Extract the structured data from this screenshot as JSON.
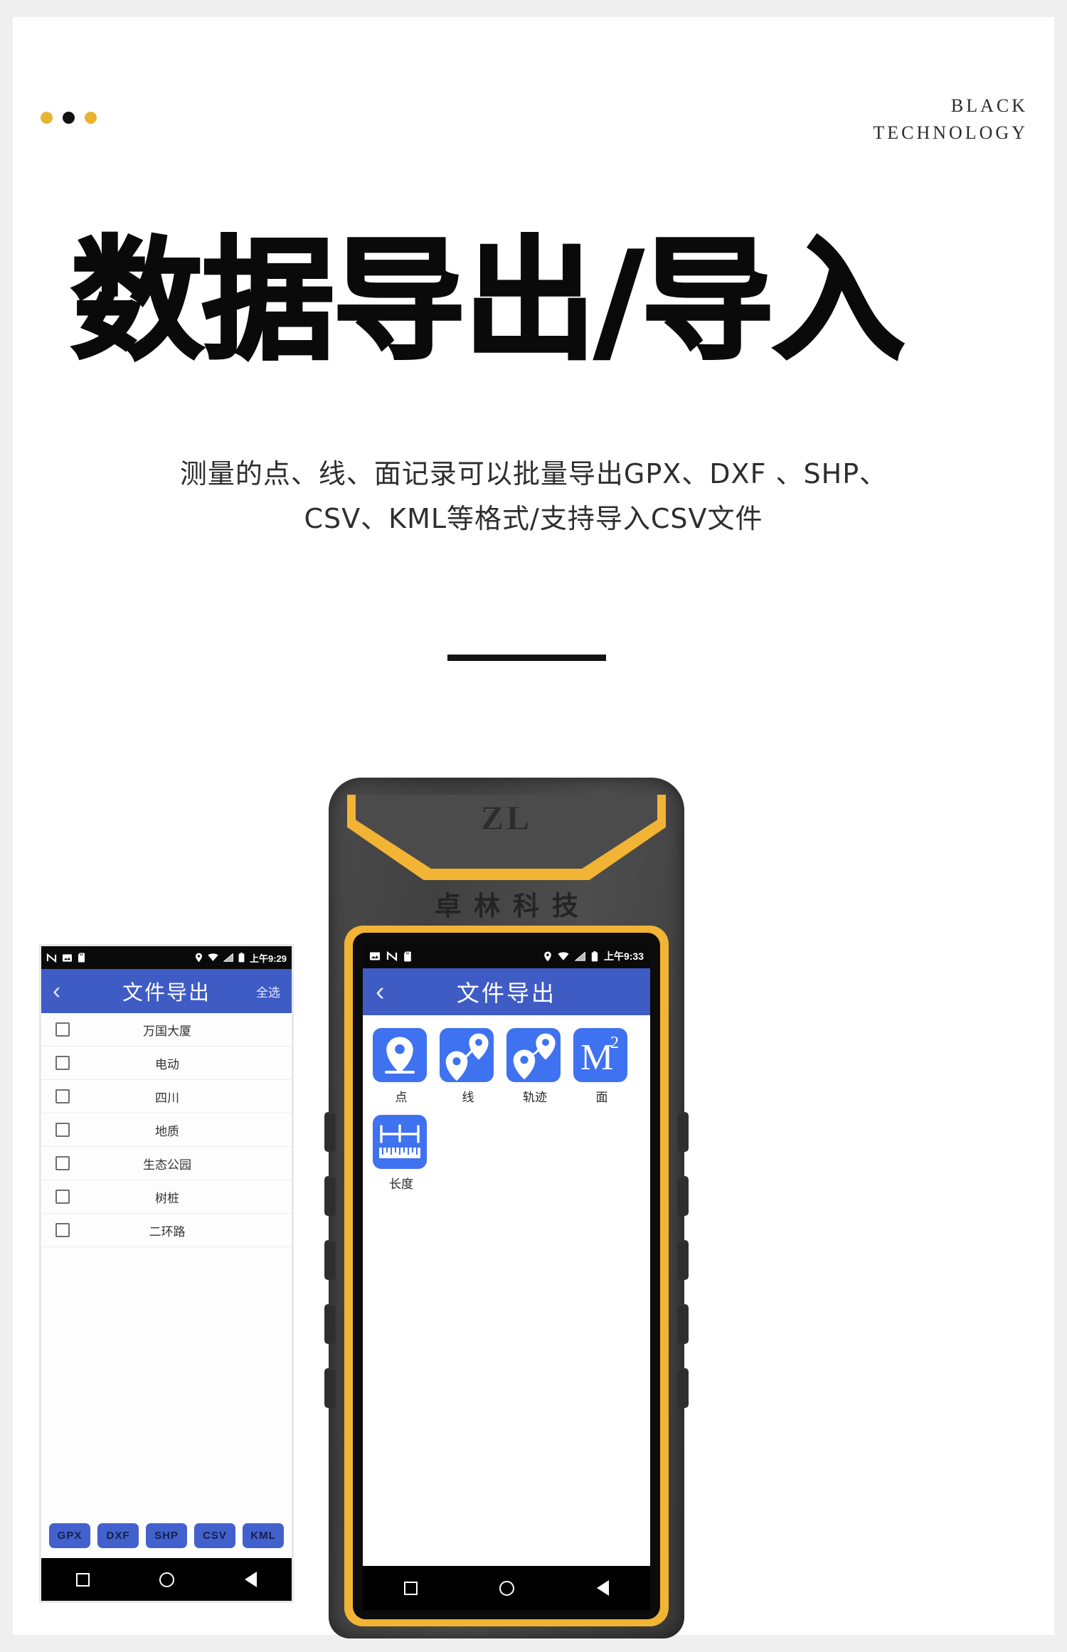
{
  "page": {
    "brand_line1": "BLACK",
    "brand_line2": "TECHNOLOGY",
    "title": "数据导出/导入",
    "subtitle_line1": "测量的点、线、面记录可以批量导出GPX、DXF 、SHP、",
    "subtitle_line2": "CSV、KML等格式/支持导入CSV文件",
    "dot_colors": [
      "#e8b431",
      "#111111",
      "#e8b431"
    ],
    "accent_yellow": "#f2b434",
    "accent_blue": "#3f5bc4",
    "icon_blue": "#3f72f0",
    "divider_color": "#141414"
  },
  "phone_left": {
    "status": {
      "icons": [
        "nfc-icon",
        "image-icon",
        "sdcard-icon",
        "location-icon",
        "wifi-icon",
        "signal-icon",
        "battery-icon"
      ],
      "time": "上午9:29"
    },
    "appbar": {
      "back": "‹",
      "title": "文件导出",
      "select_all": "全选"
    },
    "list": [
      {
        "label": "万国大厦",
        "checked": false
      },
      {
        "label": "电动",
        "checked": false
      },
      {
        "label": "四川",
        "checked": false
      },
      {
        "label": "地质",
        "checked": false
      },
      {
        "label": "生态公园",
        "checked": false
      },
      {
        "label": "树桩",
        "checked": false
      },
      {
        "label": "二环路",
        "checked": false
      }
    ],
    "formats": [
      "GPX",
      "DXF",
      "SHP",
      "CSV",
      "KML"
    ],
    "navbar": [
      "square-nav-icon",
      "circle-nav-icon",
      "triangle-back-icon"
    ]
  },
  "device_right": {
    "logo": "ZL",
    "brand": "卓林科技",
    "status": {
      "icons": [
        "image-icon",
        "nfc-icon",
        "sdcard-icon",
        "location-icon",
        "wifi-icon",
        "signal-icon",
        "battery-icon"
      ],
      "time": "上午9:33"
    },
    "appbar": {
      "back": "‹",
      "title": "文件导出"
    },
    "apps": [
      {
        "label": "点",
        "icon": "map-pin-icon"
      },
      {
        "label": "线",
        "icon": "line-segment-icon"
      },
      {
        "label": "轨迹",
        "icon": "track-path-icon"
      },
      {
        "label": "面",
        "icon": "area-m2-icon",
        "glyph": "M",
        "sup": "2"
      },
      {
        "label": "长度",
        "icon": "ruler-length-icon"
      }
    ],
    "navbar": [
      "square-nav-icon",
      "circle-nav-icon",
      "triangle-back-icon"
    ]
  }
}
